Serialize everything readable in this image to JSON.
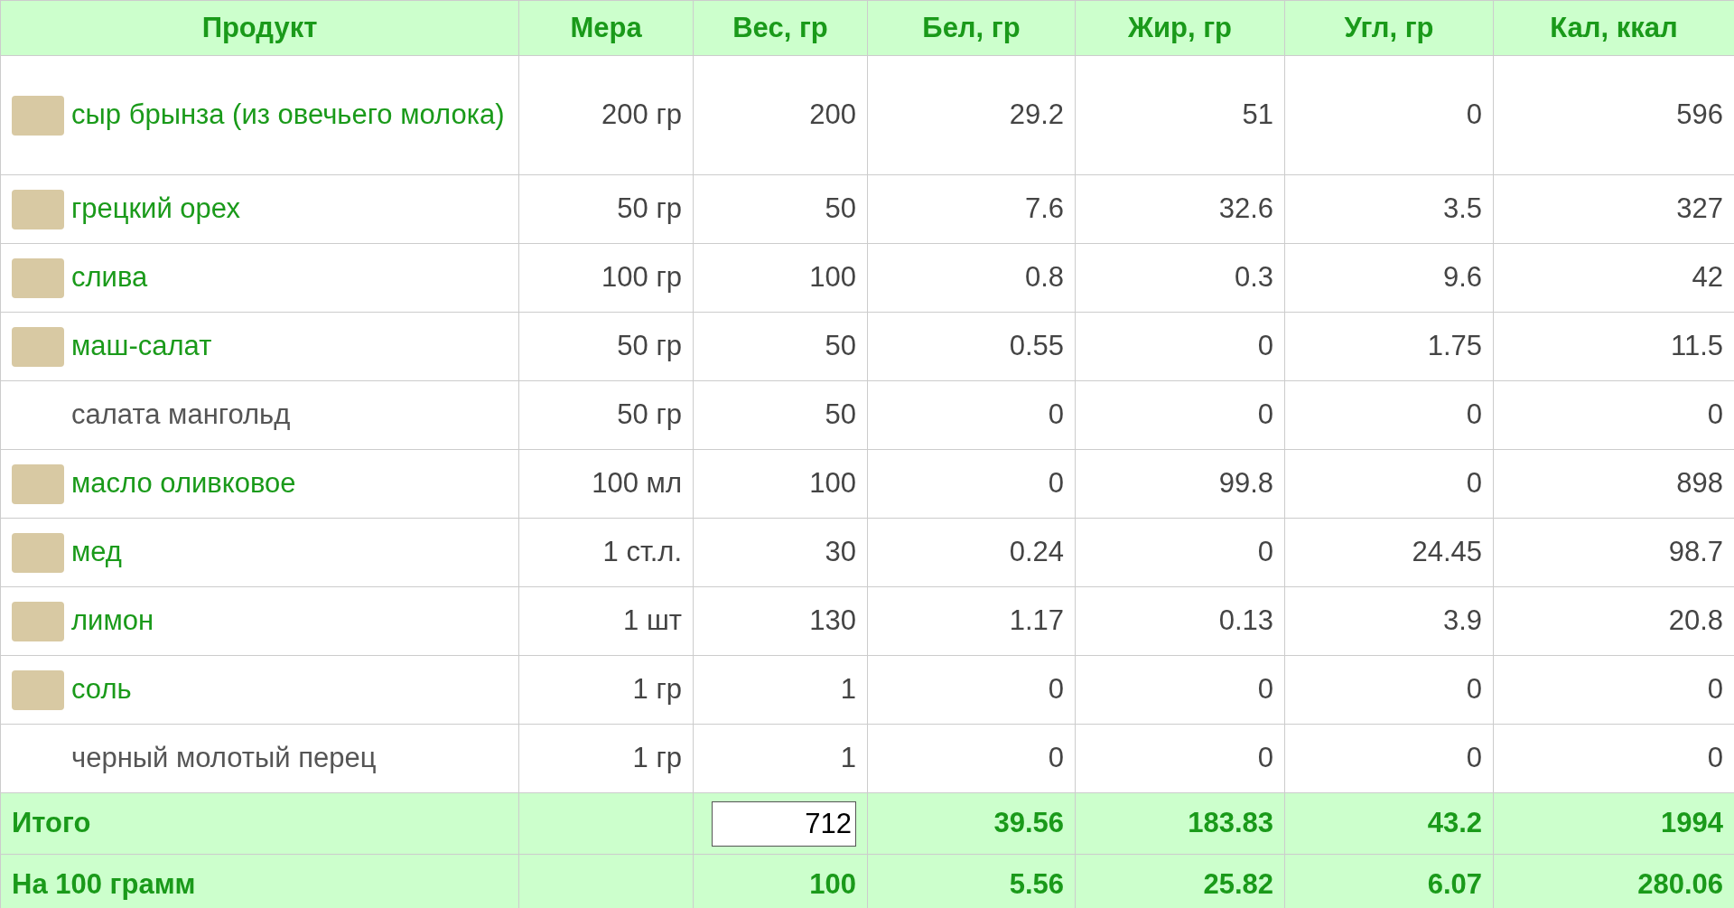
{
  "table": {
    "columns": [
      "Продукт",
      "Мера",
      "Вес, гр",
      "Бел, гр",
      "Жир, гр",
      "Угл, гр",
      "Кал, ккал"
    ],
    "rows": [
      {
        "linked": true,
        "photo": true,
        "cells": [
          "сыр брынза (из овечьего молока)",
          "200 гр",
          "200",
          "29.2",
          "51",
          "0",
          "596"
        ]
      },
      {
        "linked": true,
        "photo": true,
        "cells": [
          "грецкий орех",
          "50 гр",
          "50",
          "7.6",
          "32.6",
          "3.5",
          "327"
        ]
      },
      {
        "linked": true,
        "photo": true,
        "cells": [
          "слива",
          "100 гр",
          "100",
          "0.8",
          "0.3",
          "9.6",
          "42"
        ]
      },
      {
        "linked": true,
        "photo": true,
        "cells": [
          "маш-салат",
          "50 гр",
          "50",
          "0.55",
          "0",
          "1.75",
          "11.5"
        ]
      },
      {
        "linked": false,
        "photo": false,
        "cells": [
          "салата мангольд",
          "50 гр",
          "50",
          "0",
          "0",
          "0",
          "0"
        ]
      },
      {
        "linked": true,
        "photo": true,
        "cells": [
          "масло оливковое",
          "100 мл",
          "100",
          "0",
          "99.8",
          "0",
          "898"
        ]
      },
      {
        "linked": true,
        "photo": true,
        "cells": [
          "мед",
          "1 ст.л.",
          "30",
          "0.24",
          "0",
          "24.45",
          "98.7"
        ]
      },
      {
        "linked": true,
        "photo": true,
        "cells": [
          "лимон",
          "1 шт",
          "130",
          "1.17",
          "0.13",
          "3.9",
          "20.8"
        ]
      },
      {
        "linked": true,
        "photo": true,
        "cells": [
          "соль",
          "1 гр",
          "1",
          "0",
          "0",
          "0",
          "0"
        ]
      },
      {
        "linked": false,
        "photo": false,
        "cells": [
          "черный молотый перец",
          "1 гр",
          "1",
          "0",
          "0",
          "0",
          "0"
        ]
      }
    ],
    "totals": [
      {
        "weight_is_input": true,
        "cells": [
          "Итого",
          "",
          "712",
          "39.56",
          "183.83",
          "43.2",
          "1994"
        ]
      },
      {
        "weight_is_input": false,
        "cells": [
          "На 100 грамм",
          "",
          "100",
          "5.56",
          "25.82",
          "6.07",
          "280.06"
        ]
      }
    ]
  }
}
